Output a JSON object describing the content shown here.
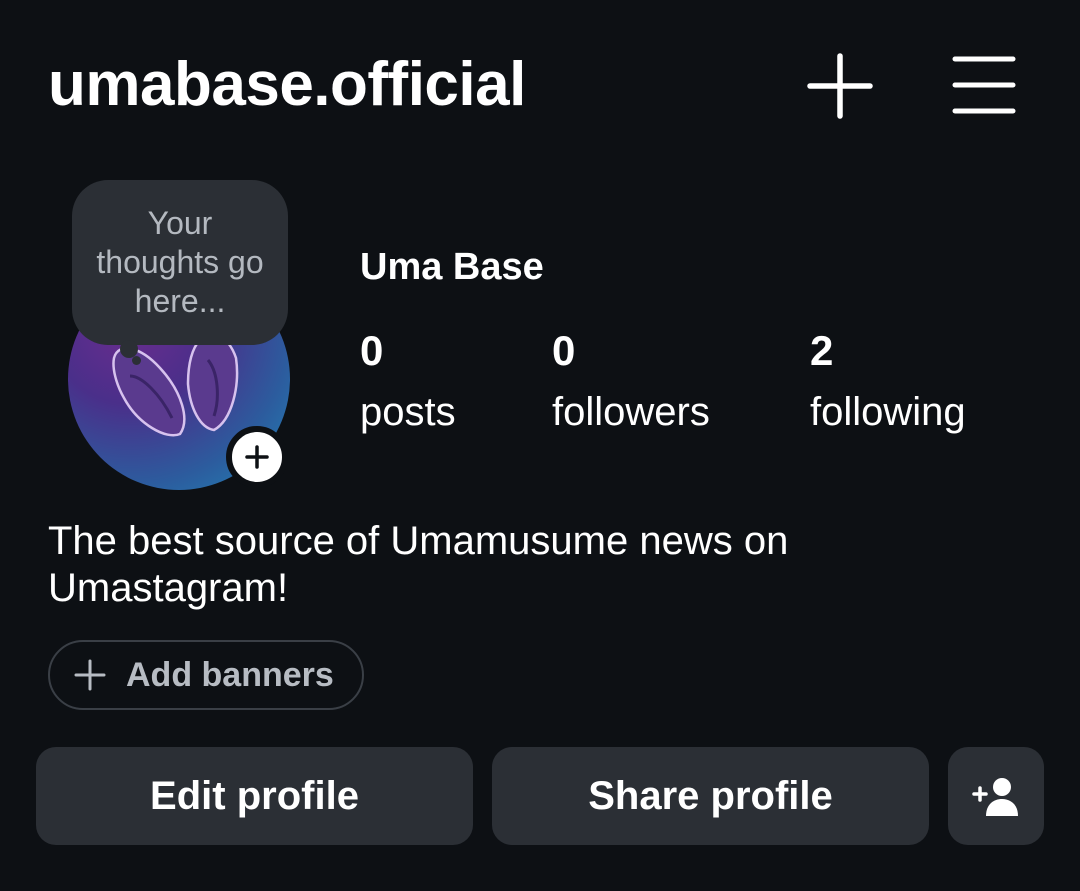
{
  "header": {
    "username": "umabase.official",
    "create_icon": "plus-icon",
    "menu_icon": "hamburger-menu-icon"
  },
  "profile": {
    "thought_bubble": "Your thoughts go here...",
    "display_name": "Uma Base",
    "stats": [
      {
        "value": "0",
        "label": "posts"
      },
      {
        "value": "0",
        "label": "followers"
      },
      {
        "value": "2",
        "label": "following"
      }
    ],
    "bio": "The best source of Umamusume news on Umastagram!",
    "add_banners_label": "Add banners"
  },
  "actions": {
    "edit_label": "Edit profile",
    "share_label": "Share profile",
    "discover_icon": "add-person-icon"
  },
  "colors": {
    "background": "#0d1014",
    "button_bg": "#2b2f35",
    "text": "#ffffff",
    "muted_text": "#b4b9c0"
  }
}
